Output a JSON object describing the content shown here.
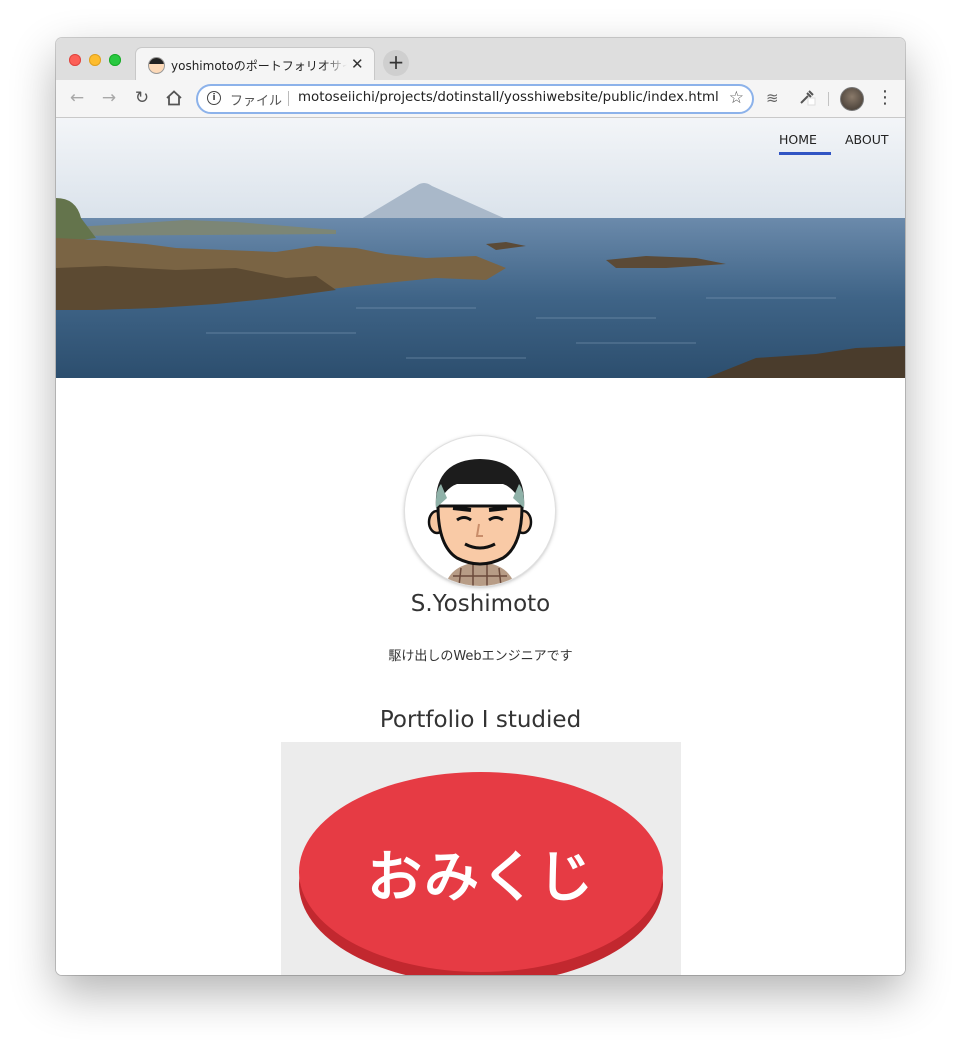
{
  "browser": {
    "tab_title": "yoshimotoのポートフォリオサイト",
    "tab_close": "✕",
    "new_tab": "+",
    "url_scheme": "ファイル",
    "url": "motoseiichi/projects/dotinstall/yosshiwebsite/public/index.html"
  },
  "nav": {
    "home": "HOME",
    "about": "ABOUT"
  },
  "profile": {
    "name": "S.Yoshimoto",
    "description": "駆け出しのWebエンジニアです"
  },
  "portfolio": {
    "title": "Portfolio I studied",
    "card_text": "おみくじ"
  },
  "colors": {
    "nav_active": "#3155c4",
    "omikuji_red": "#e63b44"
  }
}
